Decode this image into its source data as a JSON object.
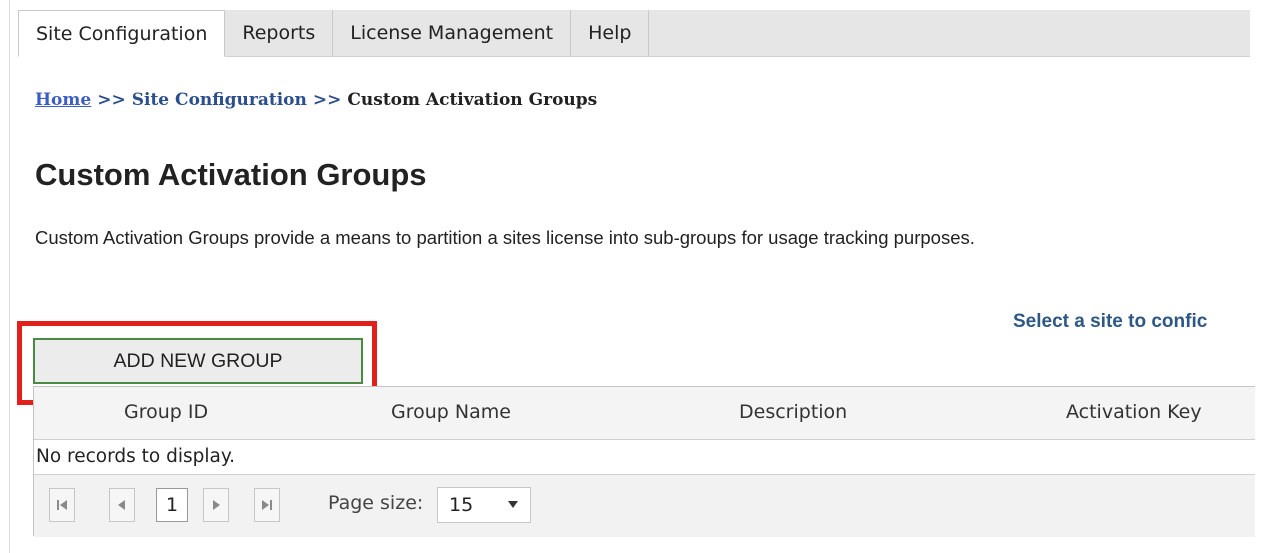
{
  "tabs": [
    {
      "label": "Site Configuration",
      "active": true
    },
    {
      "label": "Reports"
    },
    {
      "label": "License Management"
    },
    {
      "label": "Help"
    }
  ],
  "breadcrumb": {
    "home": "Home",
    "sep": ">>",
    "site_configuration": "Site Configuration",
    "current": "Custom Activation Groups"
  },
  "page": {
    "title": "Custom Activation Groups",
    "description": "Custom Activation Groups provide a means to partition a sites license into sub-groups for usage tracking purposes.",
    "site_select": "Select a site to confic"
  },
  "add_button": {
    "label": "ADD NEW GROUP"
  },
  "grid": {
    "columns": [
      "Group ID",
      "Group Name",
      "Description",
      "Activation Key"
    ],
    "empty_text": "No records to display."
  },
  "pager": {
    "current_page": "1",
    "page_size_label": "Page size:",
    "page_size": "15"
  },
  "colors": {
    "highlight": "#e2201b",
    "button_border": "#4b8a45",
    "link": "#3a5ec5"
  }
}
